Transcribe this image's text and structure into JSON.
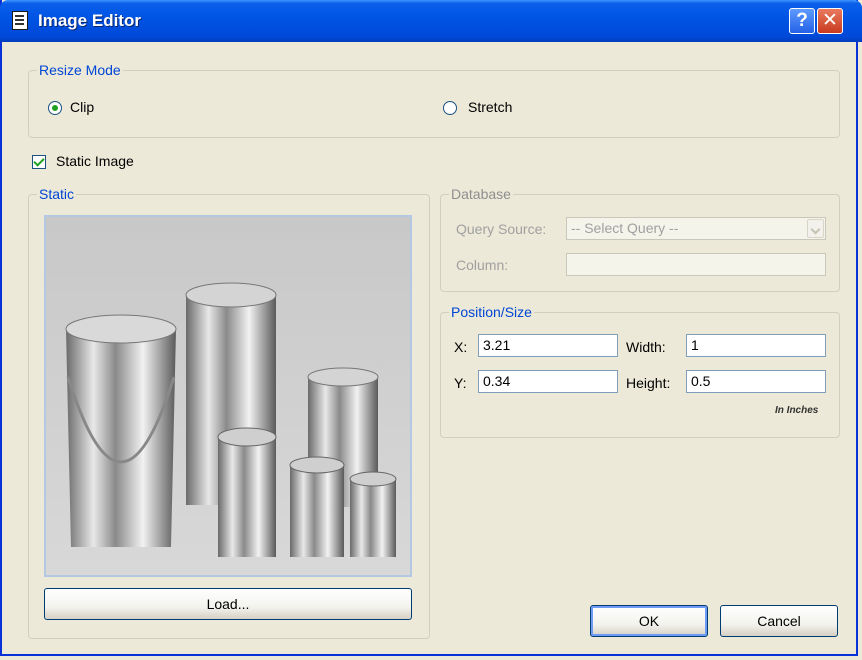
{
  "window": {
    "title": "Image Editor"
  },
  "resize_mode": {
    "legend": "Resize Mode",
    "options": [
      {
        "label": "Clip",
        "selected": true
      },
      {
        "label": "Stretch",
        "selected": false
      }
    ]
  },
  "static_image": {
    "label": "Static Image",
    "checked": true
  },
  "static": {
    "legend": "Static",
    "load_button": "Load..."
  },
  "database": {
    "legend": "Database",
    "query_source_label": "Query Source:",
    "query_source_value": "-- Select Query --",
    "column_label": "Column:",
    "column_value": ""
  },
  "position_size": {
    "legend": "Position/Size",
    "x_label": "X:",
    "x_value": "3.21",
    "y_label": "Y:",
    "y_value": "0.34",
    "width_label": "Width:",
    "width_value": "1",
    "height_label": "Height:",
    "height_value": "0.5",
    "units_note": "In Inches"
  },
  "buttons": {
    "ok": "OK",
    "cancel": "Cancel"
  },
  "colors": {
    "title_bar": "#0055E5",
    "face": "#ECE9D8",
    "group_legend": "#0046D5"
  }
}
